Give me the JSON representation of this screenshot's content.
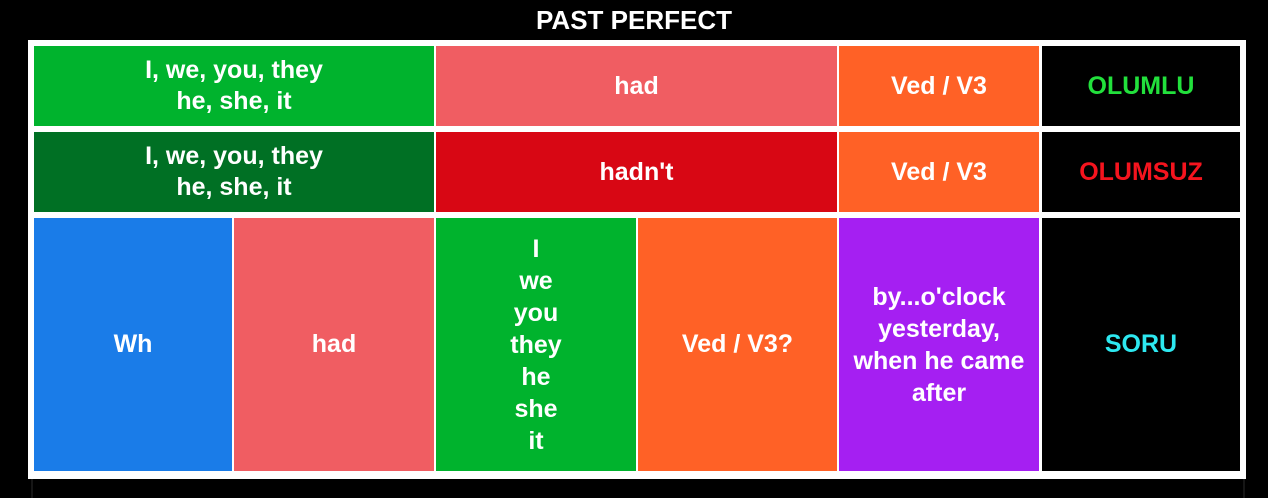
{
  "title": "PAST PERFECT",
  "colors": {
    "background": "#000000",
    "border": "#ffffff",
    "green": "#00b32d",
    "dark_green": "#007024",
    "salmon": "#f05d62",
    "red": "#d80714",
    "orange": "#ff6126",
    "blue": "#1a7ce8",
    "purple": "#a51ff2",
    "black": "#000000",
    "positive_text": "#22e03c",
    "negative_text": "#f5141e",
    "question_text": "#2de8f0"
  },
  "rows": {
    "positive": {
      "subject": "I, we, you, they\nhe, she, it",
      "auxiliary": "had",
      "verb": "Ved / V3",
      "label": "OLUMLU"
    },
    "negative": {
      "subject": "I, we, you, they\nhe, she, it",
      "auxiliary": "hadn't",
      "verb": "Ved / V3",
      "label": "OLUMSUZ"
    },
    "question": {
      "wh": "Wh",
      "auxiliary": "had",
      "subjects": "I\nwe\nyou\nthey\nhe\nshe\nit",
      "verb": "Ved / V3?",
      "time": "by...o'clock\nyesterday,\nwhen he came\nafter",
      "label": "SORU"
    }
  }
}
